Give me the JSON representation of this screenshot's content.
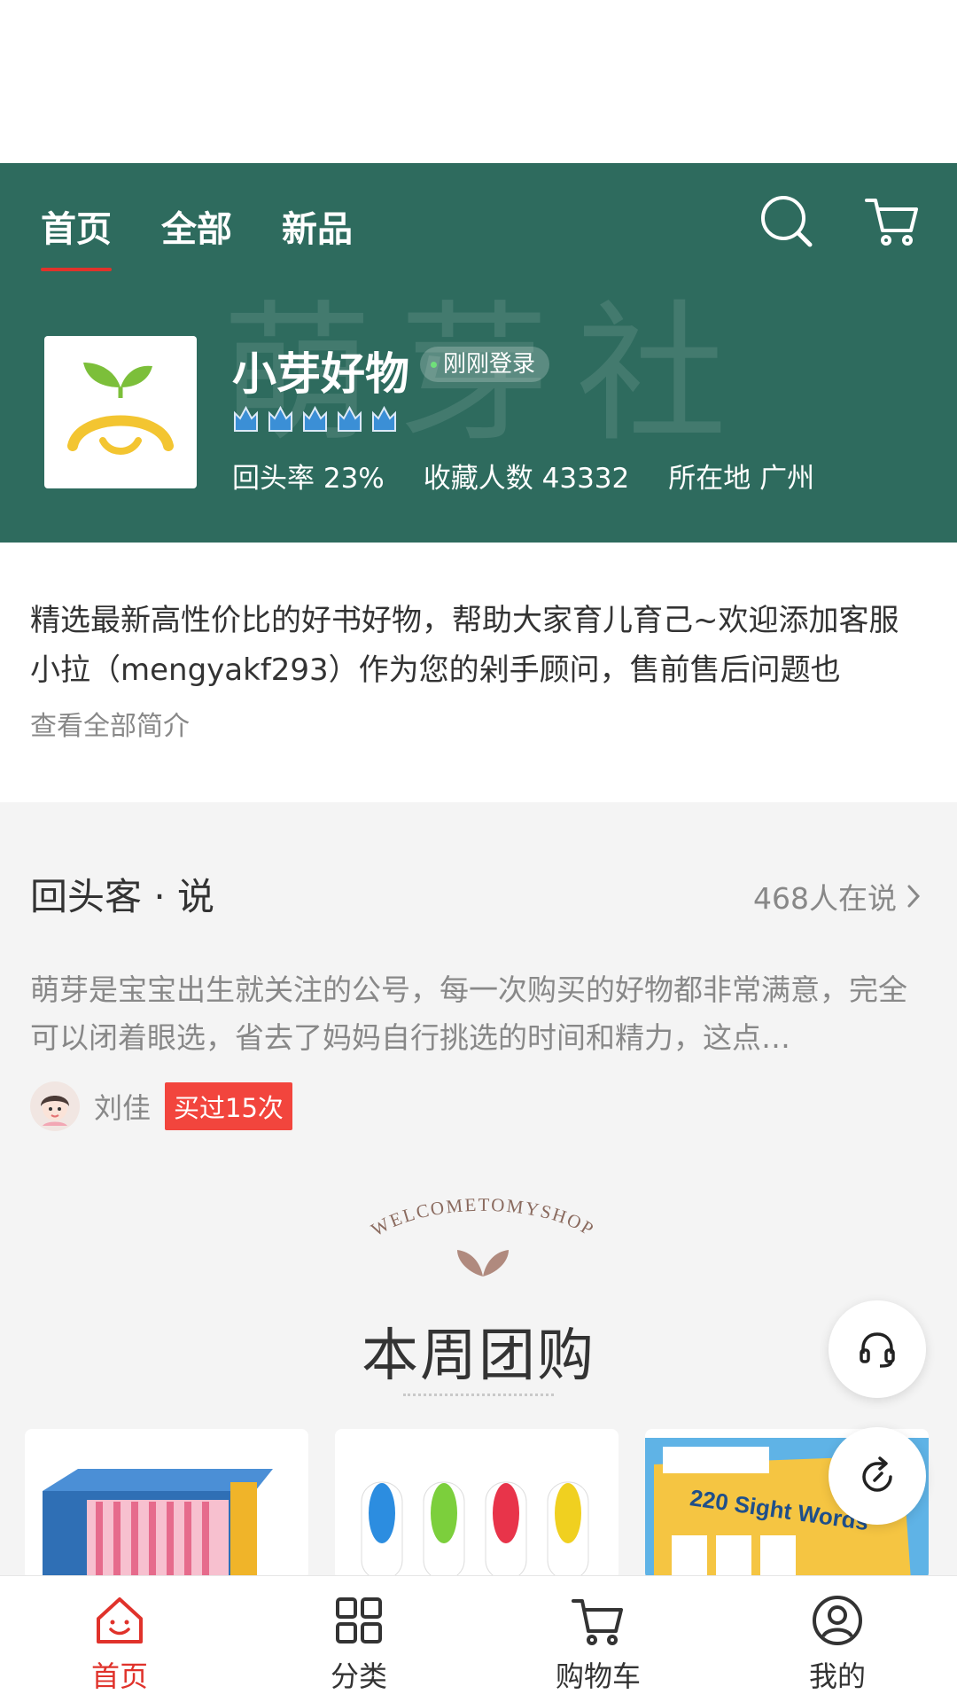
{
  "header": {
    "watermark": "萌芽社",
    "tabs": [
      {
        "label": "首页",
        "active": true
      },
      {
        "label": "全部",
        "active": false
      },
      {
        "label": "新品",
        "active": false
      }
    ],
    "icons": [
      "search-icon",
      "cart-icon"
    ]
  },
  "shop": {
    "name": "小芽好物",
    "login_status": "刚刚登录",
    "crown_count": 5,
    "stats": {
      "return_rate": "回头率 23%",
      "favorites": "收藏人数 43332",
      "location": "所在地 广州"
    }
  },
  "intro": {
    "text": "精选最新高性价比的好书好物，帮助大家育儿育己~欢迎添加客服小拉（mengyakf293）作为您的剁手顾问，售前售后问题也",
    "more_label": "查看全部简介"
  },
  "reviews": {
    "title": "回头客 · 说",
    "count_label": "468人在说",
    "text": "萌芽是宝宝出生就关注的公号，每一次购买的好物都非常满意，完全可以闭着眼选，省去了妈妈自行挑选的时间和精力，这点…",
    "reviewer_name": "刘佳",
    "reviewer_badge": "买过15次"
  },
  "promo": {
    "welcome_text": "WELCOMETOMYSHOP",
    "title": "本周团购"
  },
  "products": [
    {
      "name": "book-box"
    },
    {
      "name": "reading-pens"
    },
    {
      "name": "220 Sight Words"
    }
  ],
  "bottom_nav": [
    {
      "label": "首页",
      "icon": "home-icon",
      "active": true
    },
    {
      "label": "分类",
      "icon": "category-icon",
      "active": false
    },
    {
      "label": "购物车",
      "icon": "cart-icon",
      "active": false
    },
    {
      "label": "我的",
      "icon": "profile-icon",
      "active": false
    }
  ],
  "colors": {
    "header_bg": "#2e6b5e",
    "accent_red": "#e0322b",
    "badge_red": "#f2453d"
  }
}
